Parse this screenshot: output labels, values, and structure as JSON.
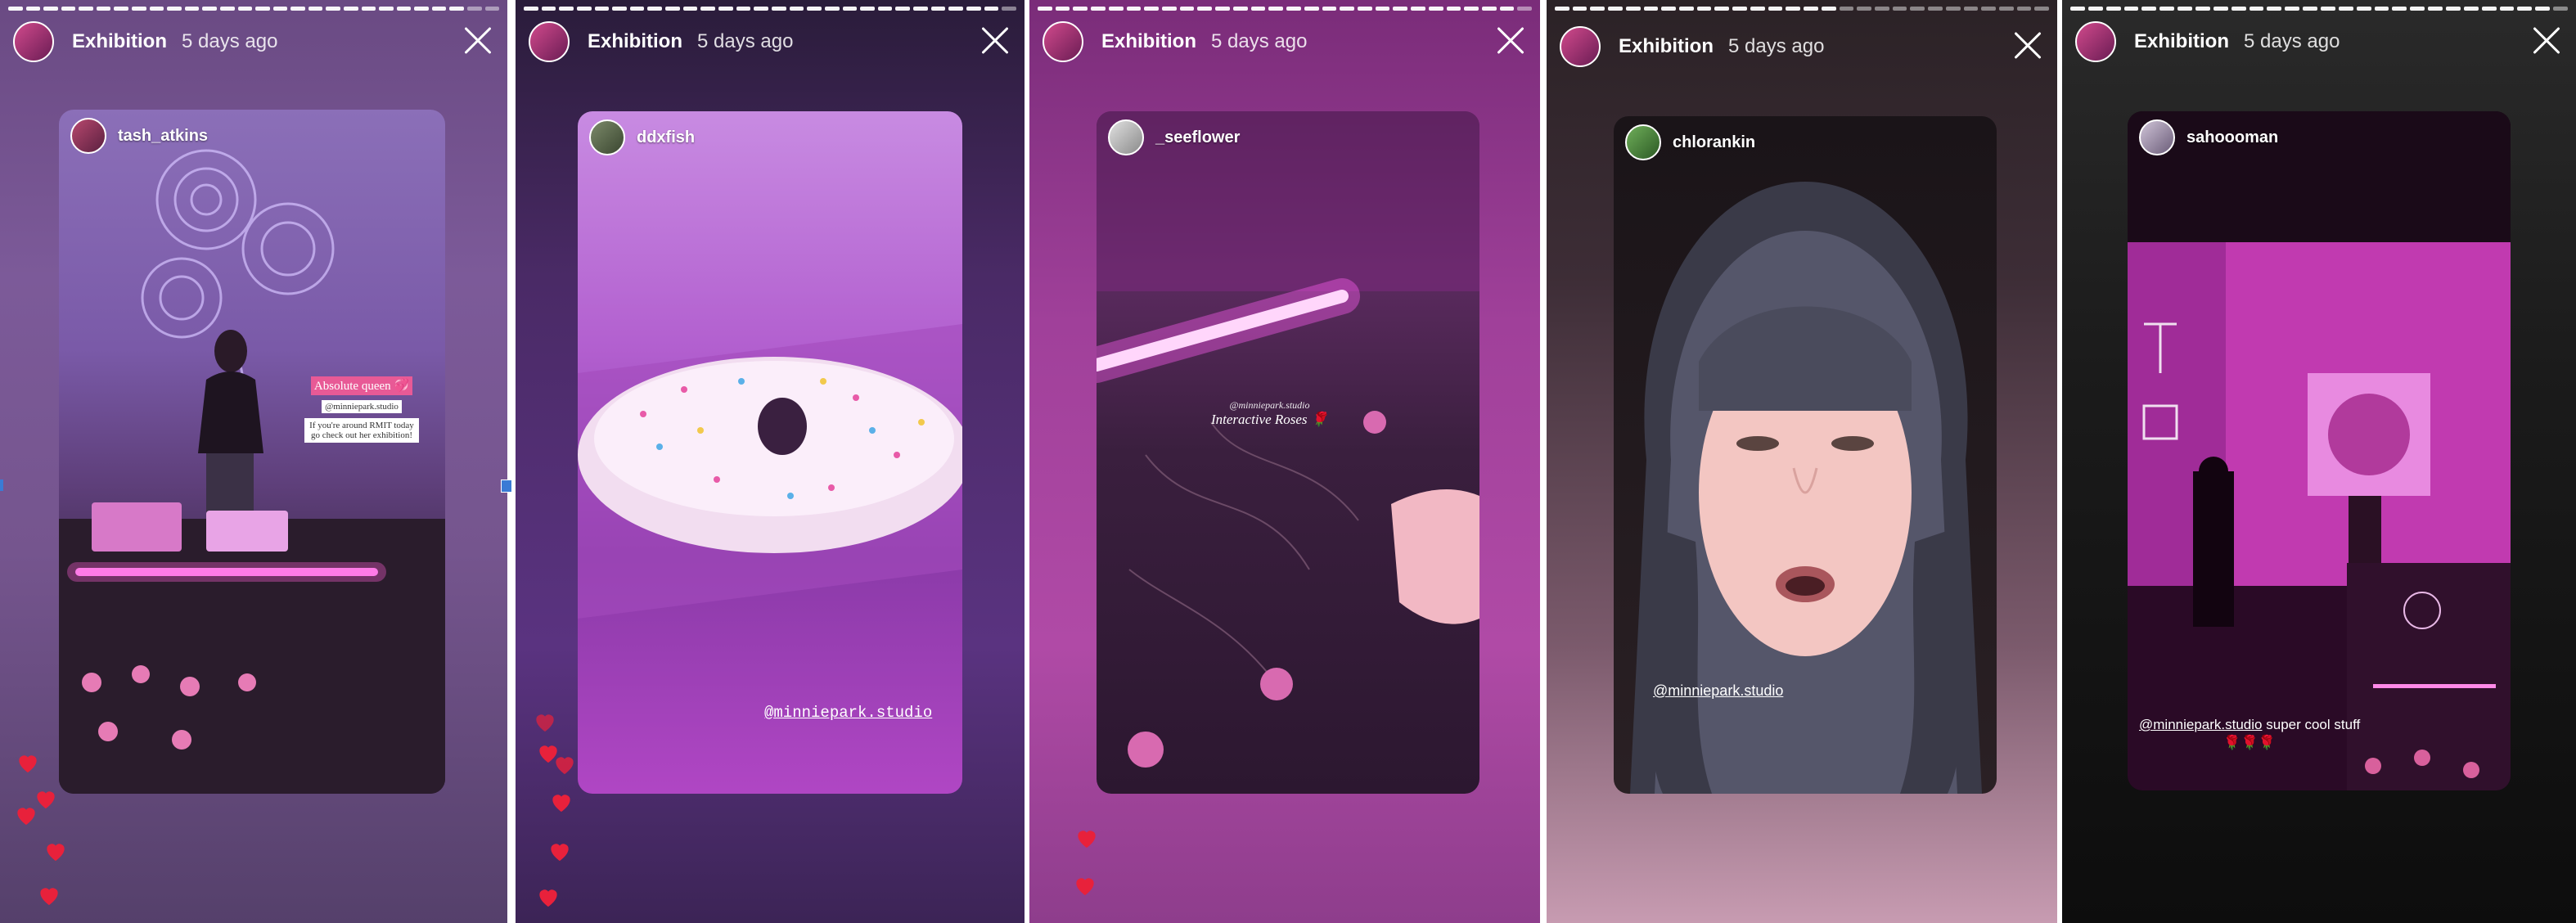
{
  "stories": [
    {
      "header": {
        "title": "Exhibition",
        "time": "5 days ago"
      },
      "user": "tash_atkins",
      "stickers": {
        "line1": "Absolute queen 💞",
        "line2": "@minniepark.studio",
        "line3": "If you're around RMIT today go check out her exhibition!"
      }
    },
    {
      "header": {
        "title": "Exhibition",
        "time": "5 days ago"
      },
      "user": "ddxfish",
      "mention": "@minniepark.studio"
    },
    {
      "header": {
        "title": "Exhibition",
        "time": "5 days ago"
      },
      "user": "_seeflower",
      "caption1": "@minniepark.studio",
      "caption2": "Interactive Roses 🌹"
    },
    {
      "header": {
        "title": "Exhibition",
        "time": "5 days ago"
      },
      "user": "chlorankin",
      "mention": "@minniepark.studio"
    },
    {
      "header": {
        "title": "Exhibition",
        "time": "5 days ago"
      },
      "user": "sahoooman",
      "mention": "@minniepark.studio",
      "caption": "super cool stuff",
      "emoji": "🌹🌹🌹"
    }
  ],
  "colors": {
    "accent": "#e0218a",
    "heart": "#e8213b"
  },
  "icons": [
    "close-icon",
    "heart-icon",
    "story-avatar-icon"
  ]
}
